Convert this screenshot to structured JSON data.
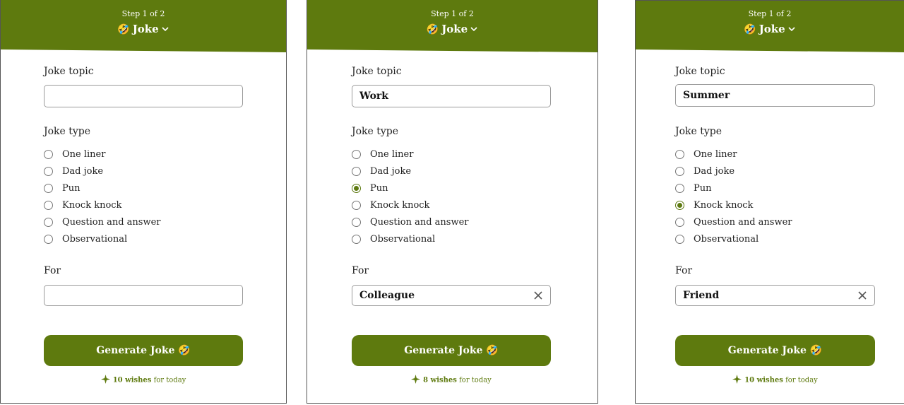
{
  "colors": {
    "brand": "#5e7a0e",
    "border": "#9a9a9a"
  },
  "panels": [
    {
      "step": "Step 1 of 2",
      "emoji": "🤣",
      "title": "Joke",
      "topic_label": "Joke topic",
      "topic_value": "",
      "type_label": "Joke type",
      "types": [
        {
          "label": "One liner",
          "checked": false
        },
        {
          "label": "Dad joke",
          "checked": false
        },
        {
          "label": "Pun",
          "checked": false
        },
        {
          "label": "Knock knock",
          "checked": false
        },
        {
          "label": "Question and answer",
          "checked": false
        },
        {
          "label": "Observational",
          "checked": false
        }
      ],
      "for_label": "For",
      "for_value": "",
      "button": "Generate Joke 🤣",
      "wishes_count": "10 wishes",
      "wishes_suffix": "for today"
    },
    {
      "step": "Step 1 of 2",
      "emoji": "🤣",
      "title": "Joke",
      "topic_label": "Joke topic",
      "topic_value": "Work",
      "type_label": "Joke type",
      "types": [
        {
          "label": "One liner",
          "checked": false
        },
        {
          "label": "Dad joke",
          "checked": false
        },
        {
          "label": "Pun",
          "checked": true
        },
        {
          "label": "Knock knock",
          "checked": false
        },
        {
          "label": "Question and answer",
          "checked": false
        },
        {
          "label": "Observational",
          "checked": false
        }
      ],
      "for_label": "For",
      "for_value": "Colleague",
      "button": "Generate Joke 🤣",
      "wishes_count": "8 wishes",
      "wishes_suffix": "for today"
    },
    {
      "step": "Step 1 of 2",
      "emoji": "🤣",
      "title": "Joke",
      "topic_label": "Joke topic",
      "topic_value": "Summer",
      "type_label": "Joke type",
      "types": [
        {
          "label": "One liner",
          "checked": false
        },
        {
          "label": "Dad joke",
          "checked": false
        },
        {
          "label": "Pun",
          "checked": false
        },
        {
          "label": "Knock knock",
          "checked": true
        },
        {
          "label": "Question and answer",
          "checked": false
        },
        {
          "label": "Observational",
          "checked": false
        }
      ],
      "for_label": "For",
      "for_value": "Friend",
      "button": "Generate Joke 🤣",
      "wishes_count": "10 wishes",
      "wishes_suffix": "for today"
    }
  ]
}
